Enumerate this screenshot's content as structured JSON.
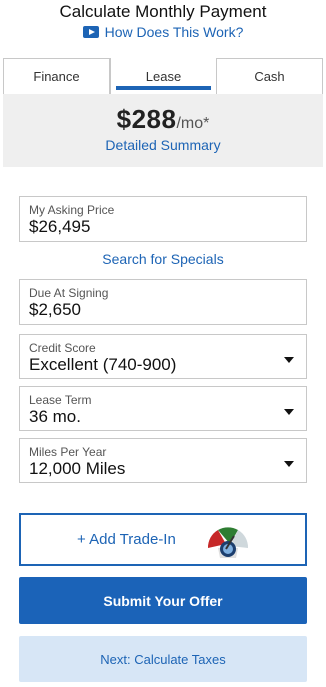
{
  "header": {
    "title": "Calculate Monthly Payment",
    "how_link": "How Does This Work?"
  },
  "tabs": [
    {
      "label": "Finance",
      "active": false
    },
    {
      "label": "Lease",
      "active": true
    },
    {
      "label": "Cash",
      "active": false
    }
  ],
  "summary": {
    "amount": "$288",
    "unit": "/mo*",
    "detail_link": "Detailed Summary"
  },
  "fields": {
    "asking_price": {
      "label": "My Asking Price",
      "value": "$26,495"
    },
    "due_at_signing": {
      "label": "Due At Signing",
      "value": "$2,650"
    },
    "credit_score": {
      "label": "Credit Score",
      "value": "Excellent (740-900)"
    },
    "lease_term": {
      "label": "Lease Term",
      "value": "36 mo."
    },
    "miles_per_year": {
      "label": "Miles Per Year",
      "value": "12,000 Miles"
    }
  },
  "specials_link": "Search for Specials",
  "buttons": {
    "trade_in": "+ Add Trade-In",
    "submit": "Submit Your Offer",
    "next": "Next: Calculate Taxes"
  },
  "colors": {
    "accent": "#1d64b5",
    "submit_bg": "#1b63b8",
    "next_bg": "#d7e6f6",
    "summary_bg": "#efefef"
  },
  "icons": {
    "play": "play-icon",
    "dropdown": "caret-down-icon",
    "trade_gauge": "value-gauge-icon"
  }
}
